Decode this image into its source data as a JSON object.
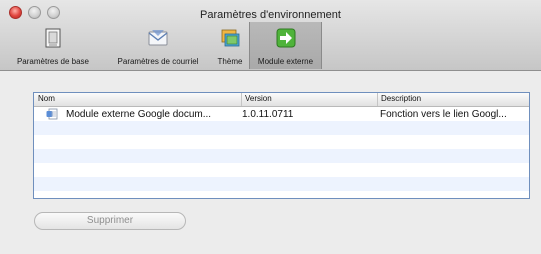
{
  "window": {
    "title": "Paramètres d'environnement"
  },
  "toolbar": {
    "items": [
      {
        "label": "Paramètres de base",
        "icon": "basic-settings-icon",
        "selected": false
      },
      {
        "label": "Paramètres de courriel",
        "icon": "mail-envelope-icon",
        "selected": false
      },
      {
        "label": "Thème",
        "icon": "theme-icon",
        "selected": false
      },
      {
        "label": "Module externe",
        "icon": "plugin-arrow-icon",
        "selected": true
      }
    ]
  },
  "table": {
    "columns": [
      "Nom",
      "Version",
      "Description"
    ],
    "rows": [
      {
        "icon": "google-docs-plugin-icon",
        "name": "Module externe Google docum...",
        "version": "1.0.11.0711",
        "description": "Fonction vers le lien Googl..."
      }
    ],
    "empty_rows": 5
  },
  "actions": {
    "remove_label": "Supprimer",
    "remove_enabled": false
  },
  "colors": {
    "accent_border": "#6f8fbd",
    "alt_row": "#edf3fe",
    "selected_tool": "#a9a9a9"
  }
}
